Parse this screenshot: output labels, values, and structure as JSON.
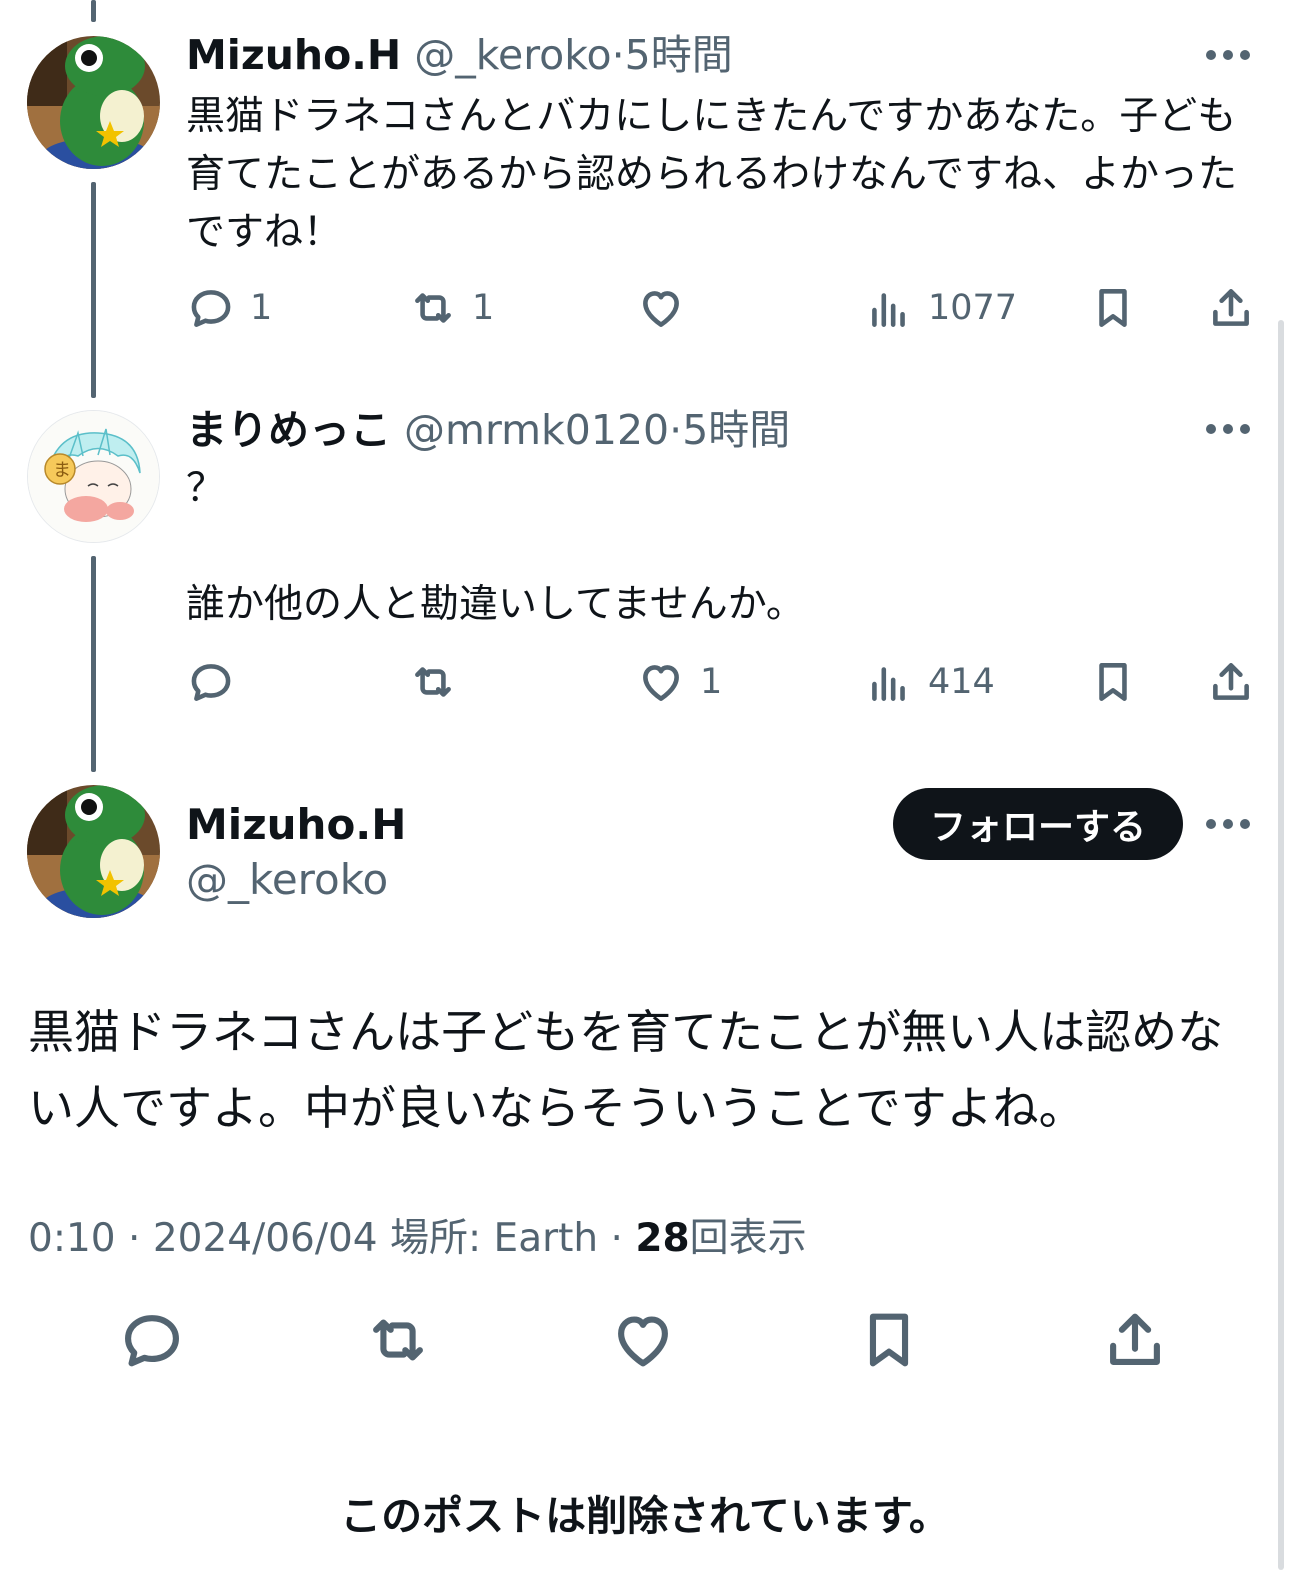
{
  "colors": {
    "text": "#0f1419",
    "secondary": "#536471",
    "follow_bg": "#0f1419",
    "follow_text": "#ffffff"
  },
  "tweet1": {
    "name": "Mizuho.H",
    "handle": "@_keroko",
    "separator": "·",
    "time": "5時間",
    "text": "黒猫ドラネコさんとバカにしにきたんですかあなた。子ども育てたことがあるから認められるわけなんですね、よかったですね！",
    "replies": "1",
    "reposts": "1",
    "likes": "",
    "views": "1077"
  },
  "tweet2": {
    "name": "まりめっこ",
    "handle": "@mrmk0120",
    "separator": "·",
    "time": "5時間",
    "text_line1": "？",
    "text_line2": "誰か他の人と勘違いしてませんか。",
    "replies": "",
    "reposts": "",
    "likes": "1",
    "views": "414"
  },
  "main": {
    "name": "Mizuho.H",
    "handle": "@_keroko",
    "follow_label": "フォローする",
    "text": "黒猫ドラネコさんは子どもを育てたことが無い人は認めない人ですよ。中が良いならそういうことですよね。",
    "time": "0:10",
    "sep1": "·",
    "date": "2024/06/04",
    "location": "場所: Earth",
    "sep2": "·",
    "views_count": "28",
    "views_label": "回表示"
  },
  "deleted_notice": "このポストは削除されています。",
  "icons": [
    "reply-icon",
    "repost-icon",
    "like-icon",
    "views-icon",
    "bookmark-icon",
    "share-icon",
    "more-icon"
  ]
}
